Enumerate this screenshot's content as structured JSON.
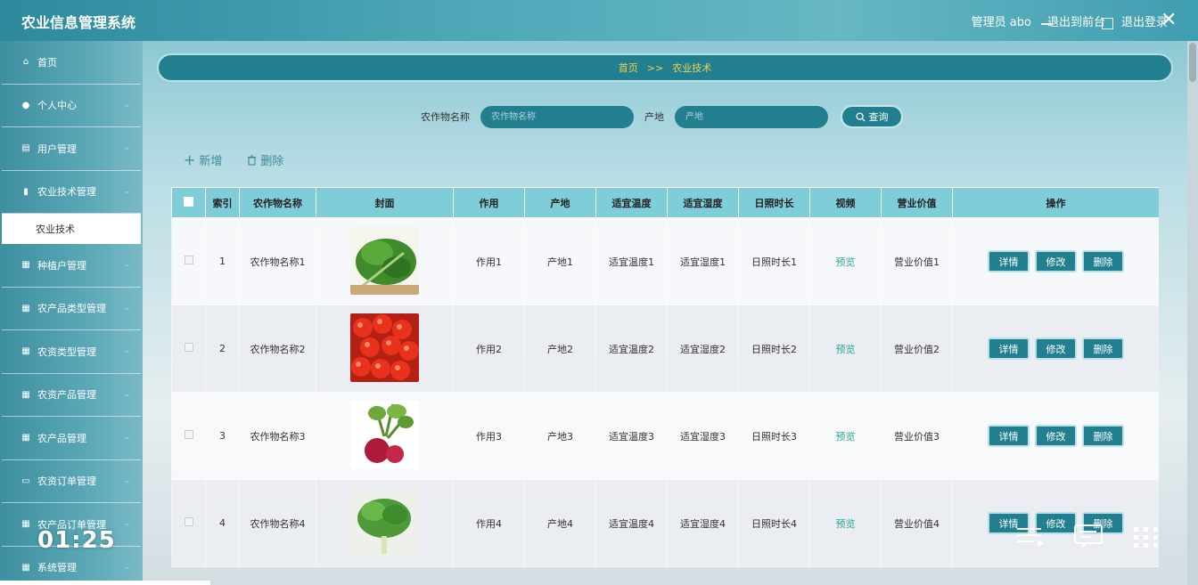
{
  "app": {
    "title": "农业信息管理系统"
  },
  "header": {
    "user": "管理员 abo",
    "exit_front": "退出到前台",
    "logout": "退出登录"
  },
  "sidebar": {
    "items": [
      {
        "label": "首页",
        "icon": "home-icon"
      },
      {
        "label": "个人中心",
        "icon": "user-icon"
      },
      {
        "label": "用户管理",
        "icon": "document-icon"
      },
      {
        "label": "农业技术管理",
        "icon": "bar-chart-icon"
      },
      {
        "label": "农业技术",
        "sub": true
      },
      {
        "label": "种植户管理",
        "icon": "grid-icon"
      },
      {
        "label": "农产品类型管理",
        "icon": "grid-icon"
      },
      {
        "label": "农资类型管理",
        "icon": "grid-icon"
      },
      {
        "label": "农资产品管理",
        "icon": "grid-icon"
      },
      {
        "label": "农产品管理",
        "icon": "grid-icon"
      },
      {
        "label": "农资订单管理",
        "icon": "monitor-icon"
      },
      {
        "label": "农产品订单管理",
        "icon": "grid-icon"
      },
      {
        "label": "系统管理",
        "icon": "grid-icon"
      }
    ]
  },
  "breadcrumb": {
    "home": "首页",
    "sep": ">>",
    "current": "农业技术"
  },
  "search": {
    "crop_label": "农作物名称",
    "crop_placeholder": "农作物名称",
    "origin_label": "产地",
    "origin_placeholder": "产地",
    "query_label": "查询"
  },
  "actions": {
    "add": "新增",
    "delete": "删除"
  },
  "table": {
    "headers": [
      "索引",
      "农作物名称",
      "封面",
      "作用",
      "产地",
      "适宜温度",
      "适宜湿度",
      "日照时长",
      "视频",
      "营业价值",
      "操作"
    ],
    "rows": [
      {
        "index": "1",
        "name": "农作物名称1",
        "cover": "greens",
        "effect": "作用1",
        "origin": "产地1",
        "temp": "适宜温度1",
        "humidity": "适宜湿度1",
        "sunlight": "日照时长1",
        "video": "预览",
        "value": "营业价值1"
      },
      {
        "index": "2",
        "name": "农作物名称2",
        "cover": "cherries",
        "effect": "作用2",
        "origin": "产地2",
        "temp": "适宜温度2",
        "humidity": "适宜湿度2",
        "sunlight": "日照时长2",
        "video": "预览",
        "value": "营业价值2"
      },
      {
        "index": "3",
        "name": "农作物名称3",
        "cover": "radish",
        "effect": "作用3",
        "origin": "产地3",
        "temp": "适宜温度3",
        "humidity": "适宜湿度3",
        "sunlight": "日照时长3",
        "video": "预览",
        "value": "营业价值3"
      },
      {
        "index": "4",
        "name": "农作物名称4",
        "cover": "lettuce",
        "effect": "作用4",
        "origin": "产地4",
        "temp": "适宜温度4",
        "humidity": "适宜湿度4",
        "sunlight": "日照时长4",
        "video": "预览",
        "value": "营业价值4"
      }
    ],
    "op_labels": {
      "detail": "详情",
      "edit": "修改",
      "delete": "删除"
    }
  },
  "video_overlay": {
    "time": "01:25"
  },
  "colors": {
    "accent": "#227f8f",
    "header_bg": "#7fcdd8",
    "link": "#2aa890"
  }
}
